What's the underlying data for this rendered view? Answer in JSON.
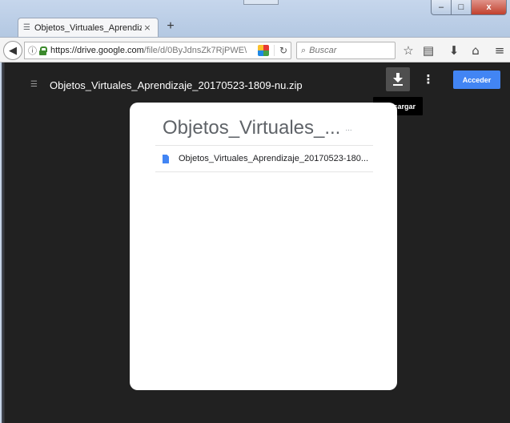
{
  "browser": {
    "tab_title": "Objetos_Virtuales_Aprendiza",
    "tab_close": "×",
    "new_tab": "+",
    "url_domain": "https://drive.google.com",
    "url_path": "/file/d/0ByJdnsZk7RjPWE\\",
    "search_placeholder": "Buscar",
    "window_controls": {
      "minimize": "–",
      "maximize": "□",
      "close": "x"
    }
  },
  "drive": {
    "file_name": "Objetos_Virtuales_Aprendizaje_20170523-1809-nu.zip",
    "more_label": "⋮",
    "signin_label": "Acceder",
    "download_tooltip": "Descargar"
  },
  "archive": {
    "title": "Objetos_Virtuales_...",
    "title_ellipsis": "...",
    "entries": [
      {
        "name": "Objetos_Virtuales_Aprendizaje_20170523-180..."
      }
    ]
  },
  "colors": {
    "viewer_bg": "#212121",
    "signin_blue": "#4285f4",
    "close_red": "#c1402d"
  }
}
